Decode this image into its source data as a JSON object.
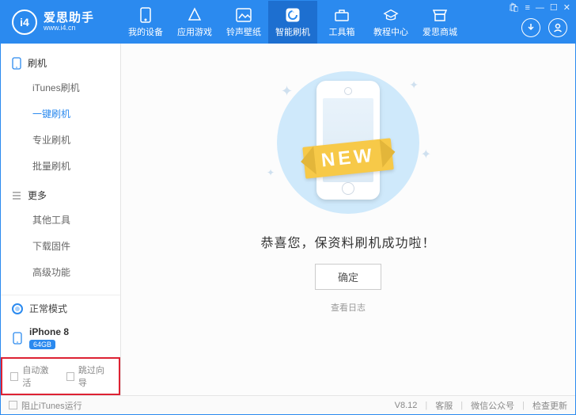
{
  "brand": {
    "name": "爱思助手",
    "url": "www.i4.cn",
    "logo_text": "i4"
  },
  "nav": [
    {
      "label": "我的设备"
    },
    {
      "label": "应用游戏"
    },
    {
      "label": "铃声壁纸"
    },
    {
      "label": "智能刷机"
    },
    {
      "label": "工具箱"
    },
    {
      "label": "教程中心"
    },
    {
      "label": "爱思商城"
    }
  ],
  "nav_active_index": 3,
  "sidebar": {
    "group1": {
      "title": "刷机",
      "items": [
        "iTunes刷机",
        "一键刷机",
        "专业刷机",
        "批量刷机"
      ],
      "active_index": 1
    },
    "group2": {
      "title": "更多",
      "items": [
        "其他工具",
        "下载固件",
        "高级功能"
      ]
    },
    "mode": "正常模式",
    "device": {
      "name": "iPhone 8",
      "capacity": "64GB"
    },
    "footer_opts": {
      "auto_activate": "自动激活",
      "skip_wizard": "跳过向导"
    }
  },
  "main": {
    "ribbon": "NEW",
    "success_text": "恭喜您，保资料刷机成功啦！",
    "ok_button": "确定",
    "view_log": "查看日志"
  },
  "bottom": {
    "block_itunes": "阻止iTunes运行",
    "version": "V8.12",
    "support": "客服",
    "wechat": "微信公众号",
    "check_update": "检查更新"
  }
}
